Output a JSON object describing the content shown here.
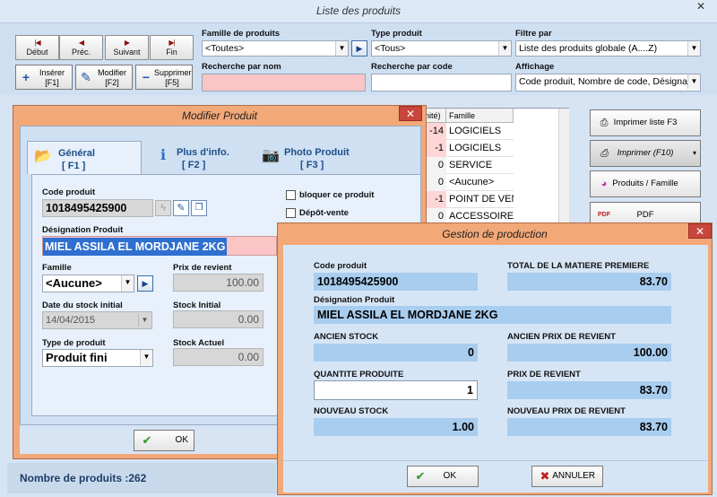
{
  "main": {
    "title": "Liste des produits",
    "close_glyph": "✕",
    "nav": [
      {
        "id": "debut",
        "label": "Début",
        "glyph": "|◀"
      },
      {
        "id": "prec",
        "label": "Préc.",
        "glyph": "◀"
      },
      {
        "id": "suivant",
        "label": "Suivant",
        "glyph": "▶"
      },
      {
        "id": "fin",
        "label": "Fin",
        "glyph": "▶|"
      }
    ],
    "actions": [
      {
        "id": "inserer",
        "label": "Insérer",
        "key": "[F1]",
        "glyph": "+"
      },
      {
        "id": "modifier",
        "label": "Modifier",
        "key": "[F2]",
        "glyph": "✎"
      },
      {
        "id": "supprimer",
        "label": "Supprimer",
        "key": "[F5]",
        "glyph": "−"
      }
    ],
    "filters": {
      "famille_label": "Famille de produits",
      "famille_value": "<Toutes>",
      "type_label": "Type produit",
      "type_value": "<Tous>",
      "filtre_label": "Filtre par",
      "filtre_value": "Liste des produits globale (A....Z)",
      "recherche_nom_label": "Recherche par nom",
      "recherche_nom_value": "",
      "recherche_code_label": "Recherche par code",
      "recherche_code_value": "",
      "affichage_label": "Affichage",
      "affichage_value": "Code produit, Nombre de code, Désigna"
    },
    "table": {
      "col_qty": "nité)",
      "col_famille": "Famille",
      "rows": [
        {
          "qty": "-14",
          "famille": "LOGICIELS",
          "neg": true
        },
        {
          "qty": "-1",
          "famille": "LOGICIELS",
          "neg": true
        },
        {
          "qty": "0",
          "famille": "SERVICE",
          "neg": false
        },
        {
          "qty": "0",
          "famille": "<Aucune>",
          "neg": false
        },
        {
          "qty": "-1",
          "famille": "POINT DE VEN",
          "neg": true
        },
        {
          "qty": "0",
          "famille": "ACCESSOIRE",
          "neg": false
        }
      ]
    },
    "side_buttons": [
      {
        "id": "imprimer-liste",
        "label": "Imprimer liste F3",
        "glyph": "⎙"
      },
      {
        "id": "imprimer",
        "label": "Imprimer (F10)",
        "glyph": "⎙"
      },
      {
        "id": "produits-famille",
        "label": "Produits / Famille",
        "glyph": "◕"
      },
      {
        "id": "pdf",
        "label": "PDF",
        "glyph": "PDF"
      }
    ],
    "status": "Nombre de produits :262"
  },
  "modifier": {
    "title": "Modifier Produit",
    "close_glyph": "✕",
    "tabs": [
      {
        "label": "Général",
        "key": "[ F1 ]"
      },
      {
        "label": "Plus d'info.",
        "key": "[ F2 ]"
      },
      {
        "label": "Photo Produit",
        "key": "[ F3 ]"
      }
    ],
    "code_label": "Code produit",
    "code_value": "1018495425900",
    "bloquer_label": "bloquer ce produit",
    "depot_label": "Dépôt-vente",
    "designation_label": "Désignation Produit",
    "designation_value": "MIEL ASSILA EL MORDJANE  2KG",
    "famille_label": "Famille",
    "famille_value": "<Aucune>",
    "prix_revient_label": "Prix de revient",
    "prix_revient_value": "100.00",
    "date_label": "Date du stock initial",
    "date_value": "14/04/2015",
    "stock_initial_label": "Stock Initial",
    "stock_initial_value": "0.00",
    "type_label": "Type de produit",
    "type_value": "Produit fini",
    "stock_actuel_label": "Stock Actuel",
    "stock_actuel_value": "0.00",
    "ok_label": "OK"
  },
  "gestion": {
    "title": "Gestion de production",
    "close_glyph": "✕",
    "code_label": "Code produit",
    "code_value": "1018495425900",
    "total_label": "TOTAL DE LA MATIERE PREMIERE",
    "total_value": "83.70",
    "designation_label": "Désignation Produit",
    "designation_value": "MIEL ASSILA EL MORDJANE  2KG",
    "ancien_stock_label": "ANCIEN STOCK",
    "ancien_stock_value": "0",
    "ancien_prix_label": "ANCIEN PRIX DE REVIENT",
    "ancien_prix_value": "100.00",
    "quantite_label": "QUANTITE PRODUITE",
    "quantite_value": "1",
    "prix_label": "PRIX DE REVIENT",
    "prix_value": "83.70",
    "nouveau_stock_label": "NOUVEAU STOCK",
    "nouveau_stock_value": "1.00",
    "nouveau_prix_label": "NOUVEAU PRIX DE REVIENT",
    "nouveau_prix_value": "83.70",
    "ok_label": "OK",
    "annuler_label": "ANNULER"
  }
}
